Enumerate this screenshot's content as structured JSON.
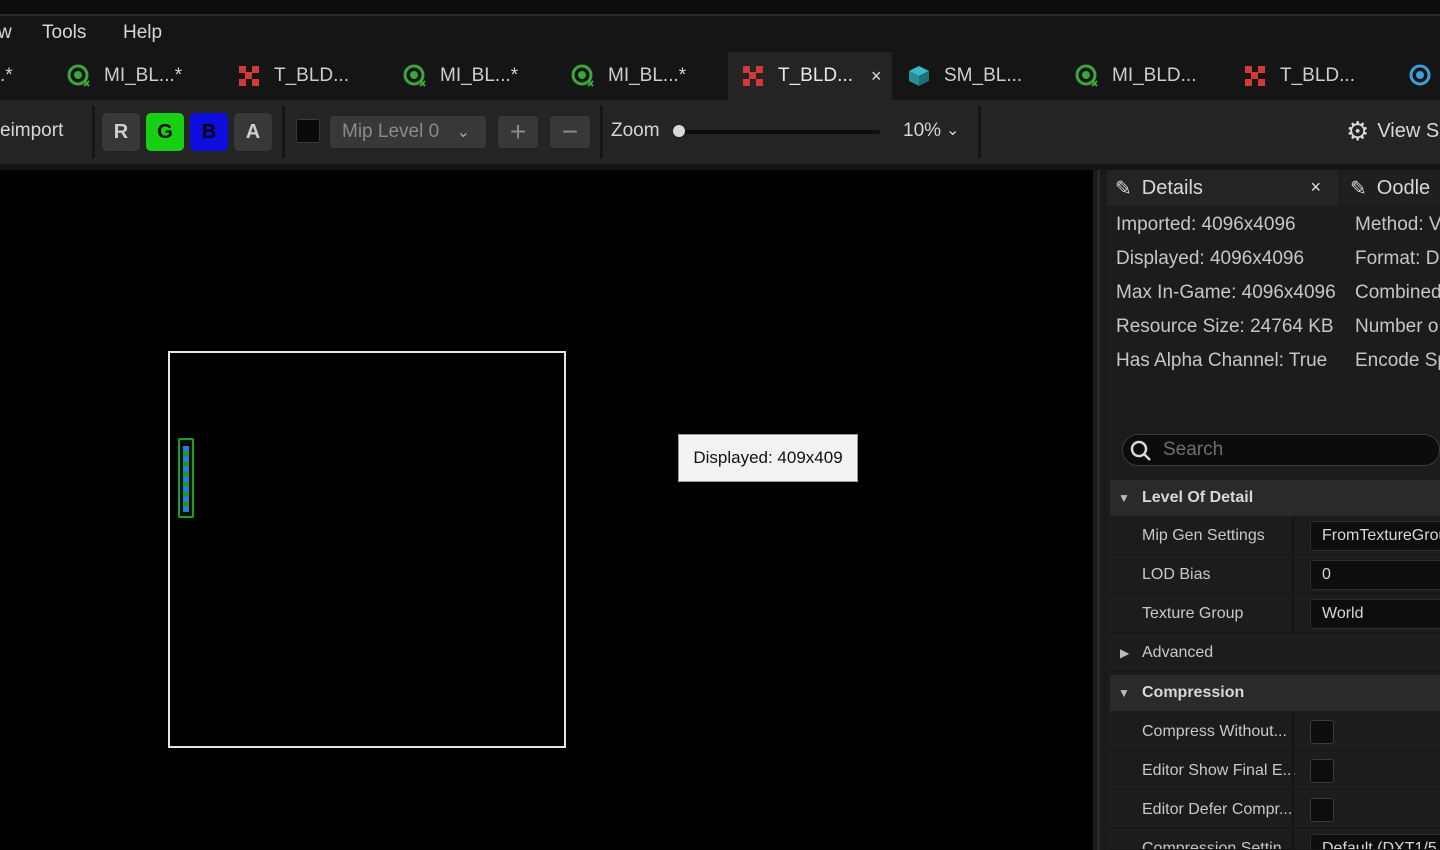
{
  "menu": {
    "partial": "w",
    "tools": "Tools",
    "help": "Help"
  },
  "tabs": [
    {
      "label": ".*",
      "icon": "material-instance-icon"
    },
    {
      "label": "MI_BL...*",
      "icon": "material-instance-icon"
    },
    {
      "label": "T_BLD...",
      "icon": "texture-icon"
    },
    {
      "label": "MI_BL...*",
      "icon": "material-instance-icon"
    },
    {
      "label": "MI_BL...*",
      "icon": "material-instance-icon"
    },
    {
      "label": "T_BLD...",
      "icon": "texture-icon",
      "active": true,
      "close": "×"
    },
    {
      "label": "SM_BL...",
      "icon": "static-mesh-icon"
    },
    {
      "label": "MI_BLD...",
      "icon": "material-instance-icon"
    },
    {
      "label": "T_BLD...",
      "icon": "texture-icon"
    }
  ],
  "toolbar": {
    "reimport": "eimport",
    "channels": [
      "R",
      "G",
      "B",
      "A"
    ],
    "mip_level": "Mip Level 0",
    "plus": "+",
    "minus": "−",
    "zoom_label": "Zoom",
    "zoom_value": "10%",
    "zoom_fraction": 0,
    "view_settings": "View S"
  },
  "viewport": {
    "tooltip": "Displayed: 409x409"
  },
  "details": {
    "tab_label": "Details",
    "tab_close": "×",
    "oodle_tab": "Oodle",
    "info_left": [
      "Imported: 4096x4096",
      "Displayed: 4096x4096",
      "Max In-Game: 4096x4096",
      "Resource Size: 24764 KB",
      "Has Alpha Channel: True"
    ],
    "info_right": [
      "Method: V",
      "Format: D",
      "Combined",
      "Number o",
      "Encode Sp"
    ],
    "search_placeholder": "Search",
    "level_of_detail": {
      "title": "Level Of Detail",
      "mip_gen_label": "Mip Gen Settings",
      "mip_gen_value": "FromTextureGrou",
      "lod_bias_label": "LOD Bias",
      "lod_bias_value": "0",
      "texture_group_label": "Texture Group",
      "texture_group_value": "World",
      "advanced_label": "Advanced"
    },
    "compression": {
      "title": "Compression",
      "compress_without_label": "Compress Without...",
      "editor_show_label": "Editor Show Final E...",
      "editor_defer_label": "Editor Defer Compr...",
      "compression_settings_label": "Compression Settin",
      "compression_settings_value": "Default (DXT1/5"
    }
  },
  "colors": {
    "green_channel": "#16d016",
    "blue_channel": "#0d0ddd",
    "panel_bg": "#1c1c1c",
    "toolbar_bg": "#242424"
  }
}
